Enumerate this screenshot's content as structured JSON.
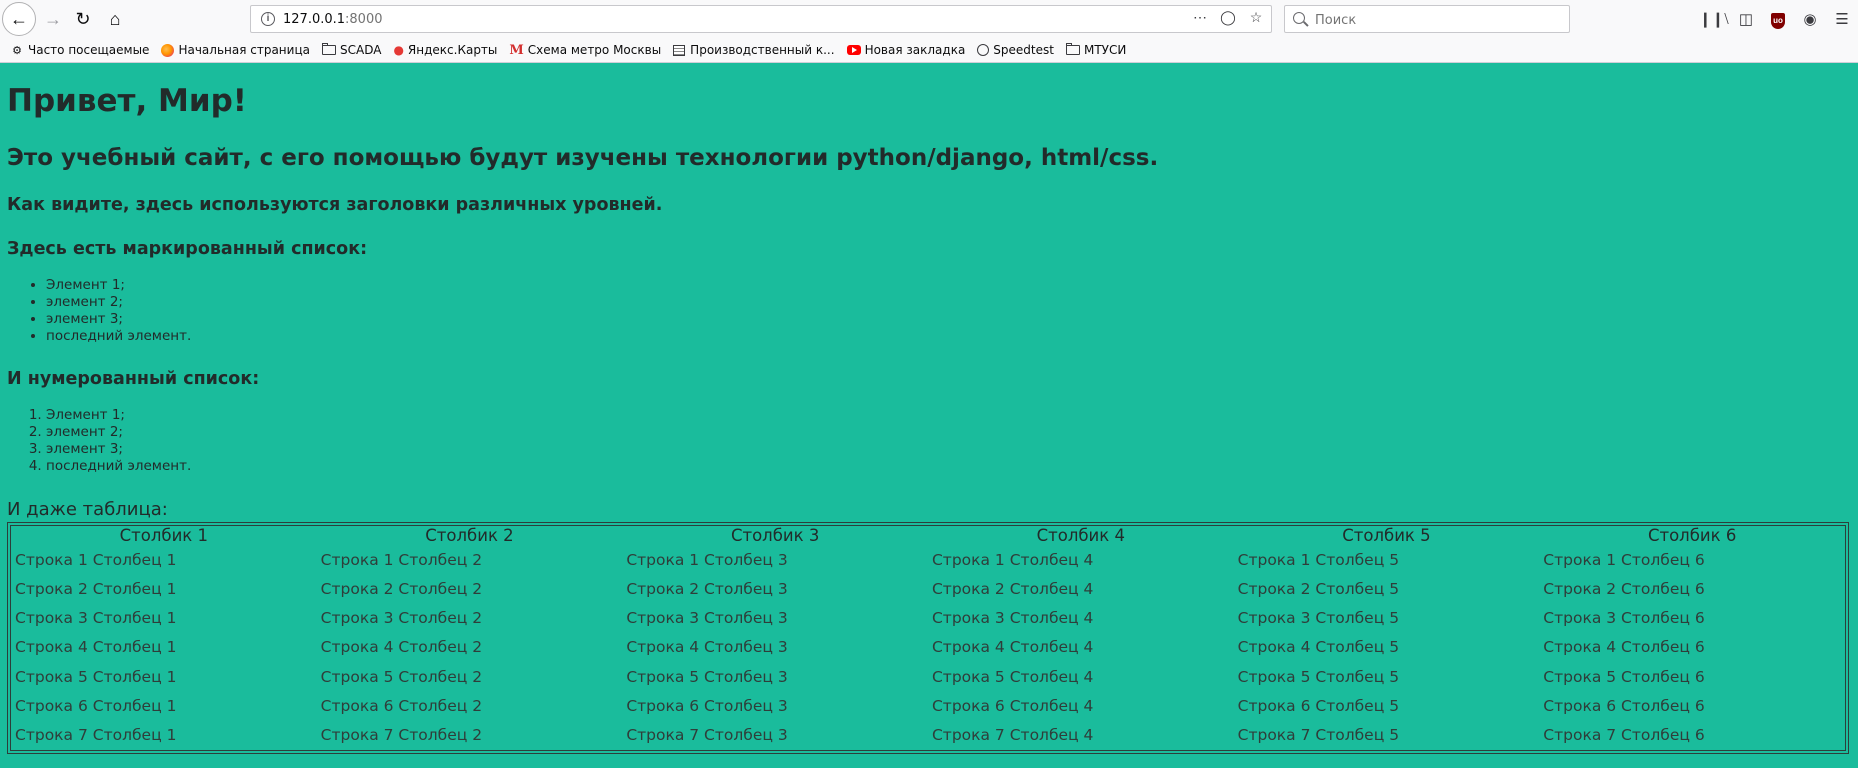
{
  "browser": {
    "url_host": "127.0.0.1",
    "url_port": ":8000",
    "search_placeholder": "Поиск",
    "toolbar_icons": [
      "library-icon",
      "sidebar-icon",
      "ublock-icon",
      "account-icon",
      "menu-icon"
    ]
  },
  "bookmarks": [
    {
      "label": "Часто посещаемые",
      "icon": "gear-icon"
    },
    {
      "label": "Начальная страница",
      "icon": "firefox-icon"
    },
    {
      "label": "SCADA",
      "icon": "folder-icon"
    },
    {
      "label": "Яндекс.Карты",
      "icon": "map-pin-icon"
    },
    {
      "label": "Схема метро Москвы",
      "icon": "metro-icon"
    },
    {
      "label": "Производственный к...",
      "icon": "document-icon"
    },
    {
      "label": "Новая закладка",
      "icon": "youtube-icon"
    },
    {
      "label": "Speedtest",
      "icon": "gauge-icon"
    },
    {
      "label": "МТУСИ",
      "icon": "folder-icon"
    }
  ],
  "page": {
    "h1": "Привет, Мир!",
    "h2": "Это учебный сайт, с его помощью будут изучены технологии python/django, html/css.",
    "h3": "Как видите, здесь используются заголовки различных уровней.",
    "ul_heading": "Здесь есть маркированный список:",
    "ul_items": [
      "Элемент 1;",
      "элемент 2;",
      "элемент 3;",
      "последний элемент."
    ],
    "ol_heading": "И нумерованный список:",
    "ol_items": [
      "Элемент 1;",
      "элемент 2;",
      "элемент 3;",
      "последний элемент."
    ],
    "table_caption": "И даже таблица:",
    "table": {
      "headers": [
        "Столбик 1",
        "Столбик 2",
        "Столбик 3",
        "Столбик 4",
        "Столбик 5",
        "Столбик 6"
      ],
      "rows": [
        [
          "Строка 1 Столбец 1",
          "Строка 1 Столбец 2",
          "Строка 1 Столбец 3",
          "Строка 1 Столбец 4",
          "Строка 1 Столбец 5",
          "Строка 1 Столбец 6"
        ],
        [
          "Строка 2 Столбец 1",
          "Строка 2 Столбец 2",
          "Строка 2 Столбец 3",
          "Строка 2 Столбец 4",
          "Строка 2 Столбец 5",
          "Строка 2 Столбец 6"
        ],
        [
          "Строка 3 Столбец 1",
          "Строка 3 Столбец 2",
          "Строка 3 Столбец 3",
          "Строка 3 Столбец 4",
          "Строка 3 Столбец 5",
          "Строка 3 Столбец 6"
        ],
        [
          "Строка 4 Столбец 1",
          "Строка 4 Столбец 2",
          "Строка 4 Столбец 3",
          "Строка 4 Столбец 4",
          "Строка 4 Столбец 5",
          "Строка 4 Столбец 6"
        ],
        [
          "Строка 5 Столбец 1",
          "Строка 5 Столбец 2",
          "Строка 5 Столбец 3",
          "Строка 5 Столбец 4",
          "Строка 5 Столбец 5",
          "Строка 5 Столбец 6"
        ],
        [
          "Строка 6 Столбец 1",
          "Строка 6 Столбец 2",
          "Строка 6 Столбец 3",
          "Строка 6 Столбец 4",
          "Строка 6 Столбец 5",
          "Строка 6 Столбец 6"
        ],
        [
          "Строка 7 Столбец 1",
          "Строка 7 Столбец 2",
          "Строка 7 Столбец 3",
          "Строка 7 Столбец 4",
          "Строка 7 Столбец 5",
          "Строка 7 Столбец 6"
        ]
      ]
    }
  },
  "colors": {
    "page_background": "#1abc9c",
    "text": "#222b2a",
    "chrome_background": "#f9f9fa"
  }
}
